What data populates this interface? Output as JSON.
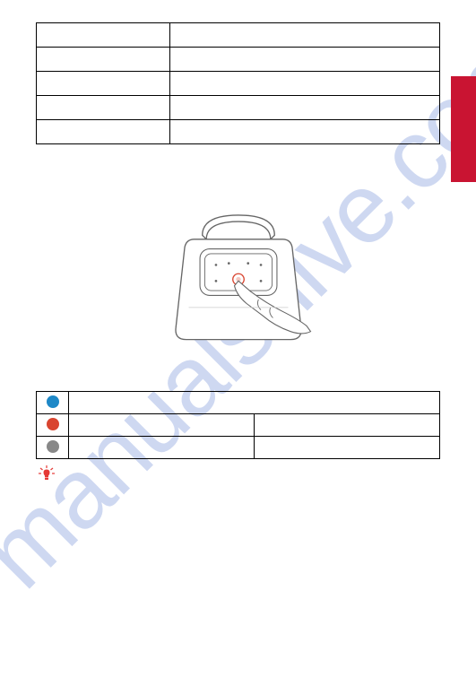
{
  "watermark_text": "manualshive.com",
  "table1": {
    "rows": [
      {
        "col1": "",
        "col2": ""
      },
      {
        "col1": "",
        "col2": ""
      },
      {
        "col1": "",
        "col2": ""
      },
      {
        "col1": "",
        "col2": ""
      },
      {
        "col1": "",
        "col2": ""
      }
    ]
  },
  "table2": {
    "rows": [
      {
        "color": "#1e88c7",
        "label": "",
        "value": "",
        "colspan": true
      },
      {
        "color": "#d94530",
        "label": "",
        "value": ""
      },
      {
        "color": "#888888",
        "label": "",
        "value": ""
      }
    ]
  },
  "tip_icon_color": "#e53935"
}
